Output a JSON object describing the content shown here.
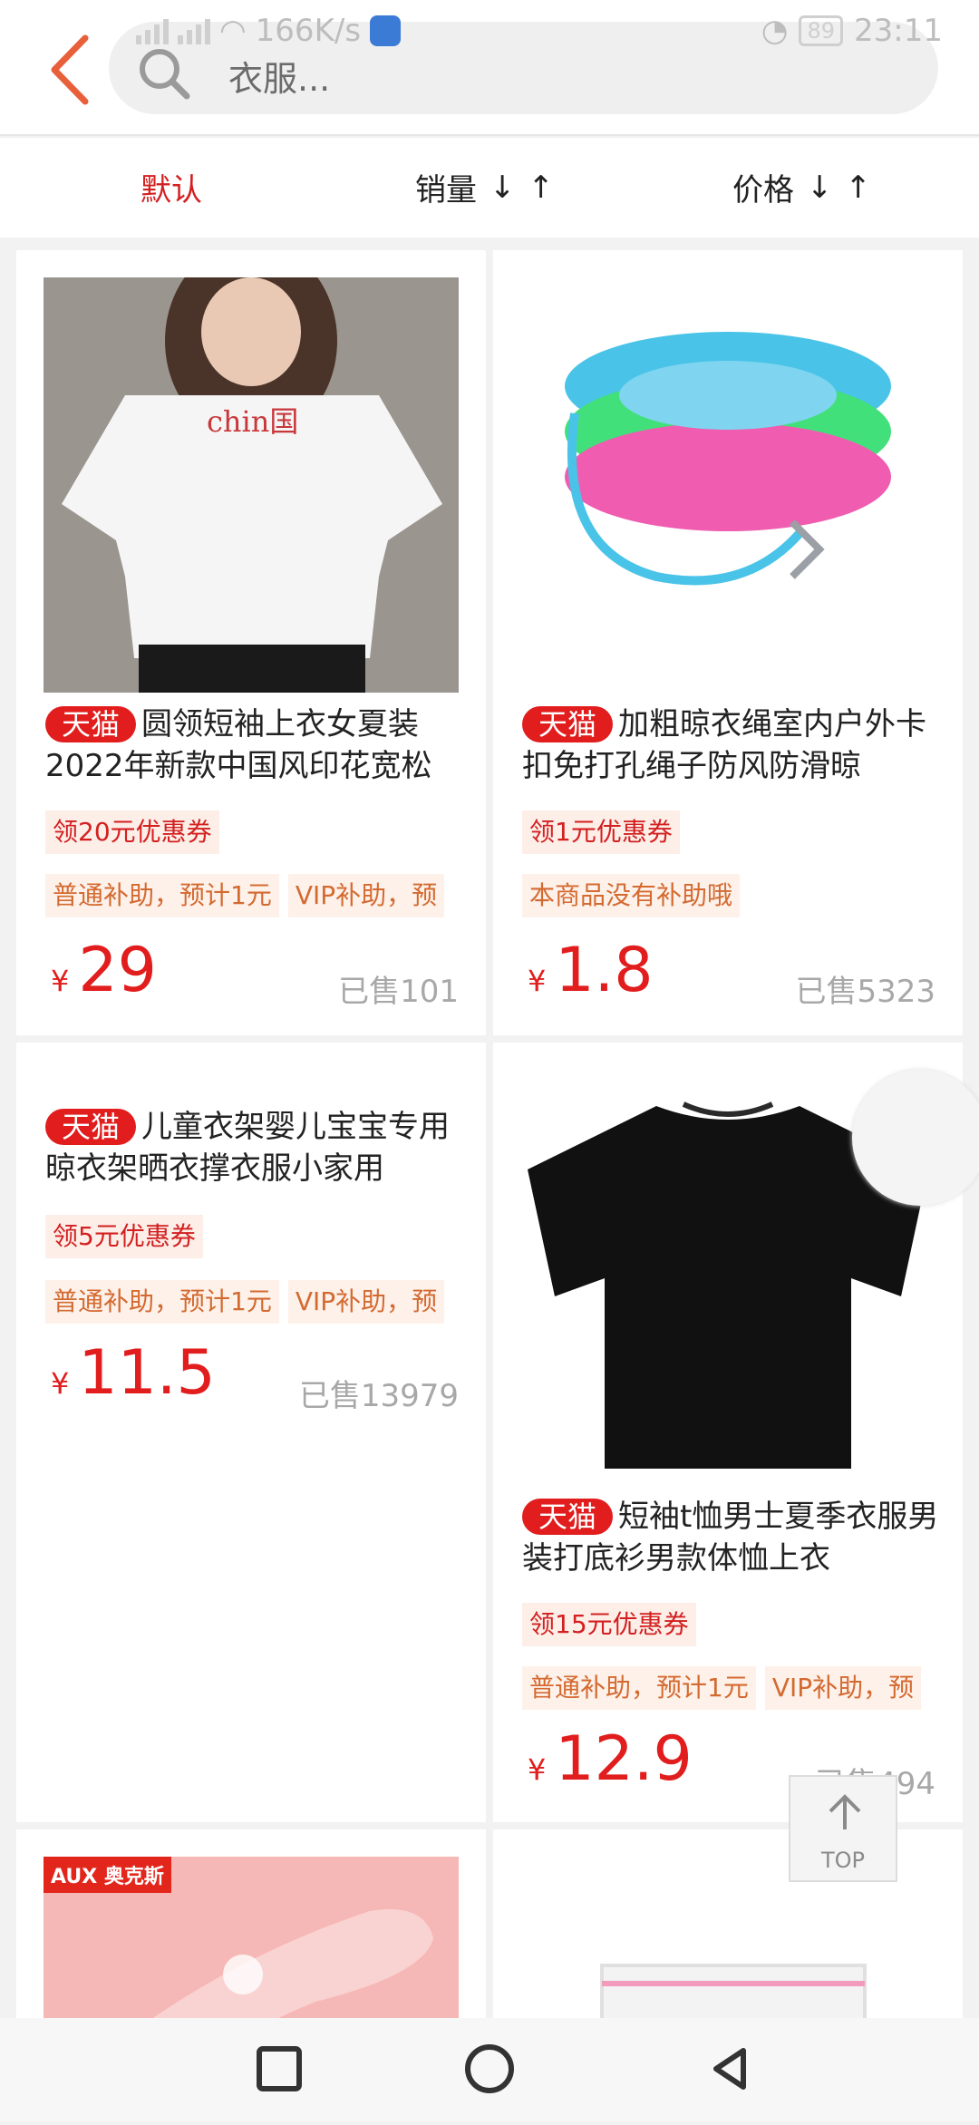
{
  "status": {
    "speed": "166K/s",
    "battery": "89",
    "time": "23:11"
  },
  "search": {
    "placeholder": "衣服..."
  },
  "sort": {
    "default": "默认",
    "sales": "销量",
    "price": "价格",
    "down": "↓",
    "up": "↑"
  },
  "tmall_label": "天猫",
  "products": [
    {
      "title": "圆领短袖上衣女夏装2022年新款中国风印花宽松",
      "coupon": "领20元优惠券",
      "tags": [
        "普通补助，预计1元",
        "VIP补助，预"
      ],
      "currency": "¥",
      "price": "29",
      "sold": "已售101",
      "print_text": "chin国"
    },
    {
      "title": "加粗晾衣绳室内户外卡扣免打孔绳子防风防滑晾",
      "coupon": "领1元优惠券",
      "tags": [
        "本商品没有补助哦"
      ],
      "currency": "¥",
      "price": "1.8",
      "sold": "已售5323"
    },
    {
      "title": "儿童衣架婴儿宝宝专用晾衣架晒衣撑衣服小家用",
      "coupon": "领5元优惠券",
      "tags": [
        "普通补助，预计1元",
        "VIP补助，预"
      ],
      "currency": "¥",
      "price": "11.5",
      "sold": "已售13979"
    },
    {
      "title": "短袖t恤男士夏季衣服男装打底衫男款体恤上衣",
      "coupon": "领15元优惠券",
      "tags": [
        "普通补助，预计1元",
        "VIP补助，预"
      ],
      "currency": "¥",
      "price": "12.9",
      "sold": "已售494"
    },
    {
      "brand_logo": "AUX 奥克斯"
    }
  ],
  "top_button": {
    "label": "TOP"
  },
  "colors": {
    "accent": "#e11d1d",
    "back": "#e8603a"
  }
}
